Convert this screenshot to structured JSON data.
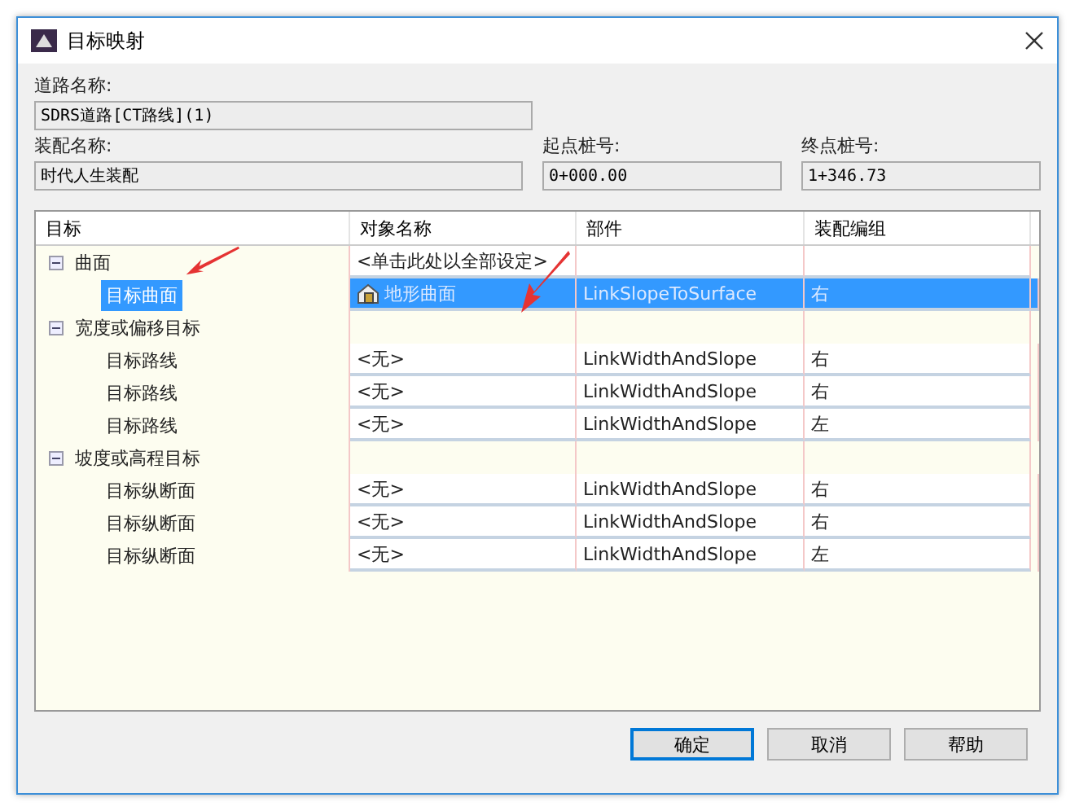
{
  "window": {
    "title": "目标映射"
  },
  "fields": {
    "road_name": {
      "label": "道路名称:",
      "value": "SDRS道路[CT路线](1)"
    },
    "assembly_name": {
      "label": "装配名称:",
      "value": "时代人生装配"
    },
    "start_station": {
      "label": "起点桩号:",
      "value": "0+000.00"
    },
    "end_station": {
      "label": "终点桩号:",
      "value": "1+346.73"
    }
  },
  "table": {
    "columns": [
      "目标",
      "对象名称",
      "部件",
      "装配编组"
    ],
    "groups": [
      {
        "label": "曲面",
        "expanded": true,
        "object_name": "<单击此处以全部设定>",
        "children": [
          {
            "label": "目标曲面",
            "object_name": "地形曲面",
            "kind": "surface",
            "part": "LinkSlopeToSurface",
            "group": "右",
            "selected": true
          }
        ]
      },
      {
        "label": "宽度或偏移目标",
        "expanded": true,
        "children": [
          {
            "label": "目标路线",
            "object_name": "<无>",
            "part": "LinkWidthAndSlope",
            "group": "右",
            "selected": false
          },
          {
            "label": "目标路线",
            "object_name": "<无>",
            "part": "LinkWidthAndSlope",
            "group": "右",
            "selected": false
          },
          {
            "label": "目标路线",
            "object_name": "<无>",
            "part": "LinkWidthAndSlope",
            "group": "左",
            "selected": false
          }
        ]
      },
      {
        "label": "坡度或高程目标",
        "expanded": true,
        "children": [
          {
            "label": "目标纵断面",
            "object_name": "<无>",
            "part": "LinkWidthAndSlope",
            "group": "右",
            "selected": false
          },
          {
            "label": "目标纵断面",
            "object_name": "<无>",
            "part": "LinkWidthAndSlope",
            "group": "右",
            "selected": false
          },
          {
            "label": "目标纵断面",
            "object_name": "<无>",
            "part": "LinkWidthAndSlope",
            "group": "左",
            "selected": false
          }
        ]
      }
    ]
  },
  "buttons": [
    {
      "label": "确定",
      "default": true
    },
    {
      "label": "取消",
      "default": false
    },
    {
      "label": "帮助",
      "default": false
    }
  ]
}
